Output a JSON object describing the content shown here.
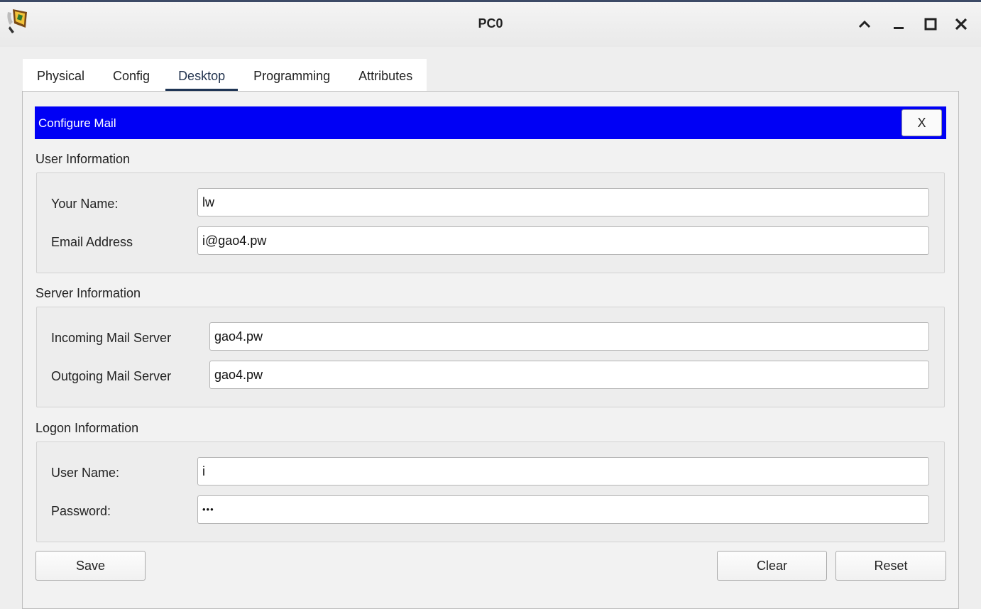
{
  "window": {
    "title": "PC0",
    "icons": {
      "app": "packet-tracer-pc-icon",
      "restore": "chevron-up-icon",
      "minimize": "minimize-icon",
      "maximize": "maximize-icon",
      "close": "close-icon"
    }
  },
  "tabs": [
    {
      "label": "Physical",
      "active": false
    },
    {
      "label": "Config",
      "active": false
    },
    {
      "label": "Desktop",
      "active": true
    },
    {
      "label": "Programming",
      "active": false
    },
    {
      "label": "Attributes",
      "active": false
    }
  ],
  "dialog": {
    "title": "Configure Mail",
    "close_label": "X",
    "header_color": "#0000f5"
  },
  "user_info": {
    "title": "User Information",
    "name_label": "Your Name:",
    "name_value": "lw",
    "email_label": "Email Address",
    "email_value": "i@gao4.pw"
  },
  "server_info": {
    "title": "Server Information",
    "incoming_label": "Incoming Mail Server",
    "incoming_value": "gao4.pw",
    "outgoing_label": "Outgoing Mail Server",
    "outgoing_value": "gao4.pw"
  },
  "logon_info": {
    "title": "Logon Information",
    "username_label": "User Name:",
    "username_value": "i",
    "password_label": "Password:",
    "password_value": "•••"
  },
  "buttons": {
    "save": "Save",
    "clear": "Clear",
    "reset": "Reset"
  }
}
